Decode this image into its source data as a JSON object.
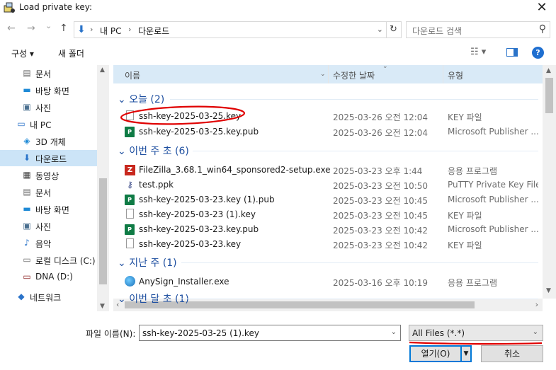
{
  "window": {
    "title": "Load private key:",
    "close_glyph": "✕"
  },
  "navigation": {
    "back_glyph": "←",
    "forward_glyph": "→",
    "recent_glyph": "⌄",
    "up_glyph": "↑",
    "breadcrumb": [
      "내 PC",
      "다운로드"
    ],
    "breadcrumb_sep": "›",
    "dropdown_glyph": "⌄",
    "refresh_glyph": "↻",
    "search_placeholder": "다운로드 검색",
    "search_glyph": "⚲"
  },
  "toolbar": {
    "organize_label": "구성 ▾",
    "new_folder_label": "새 폴더",
    "view_glyph": "☷ ▾",
    "help_glyph": "?"
  },
  "sidebar": {
    "items": [
      {
        "label": "문서",
        "icon": "documents-icon",
        "glyph": "▤",
        "color": "#6b6b6b"
      },
      {
        "label": "바탕 화면",
        "icon": "desktop-icon",
        "glyph": "▬",
        "color": "#1e8ad6"
      },
      {
        "label": "사진",
        "icon": "pictures-icon",
        "glyph": "▣",
        "color": "#4a6f8f"
      },
      {
        "label": "내 PC",
        "icon": "computer-icon",
        "glyph": "▭",
        "color": "#2a73c9"
      },
      {
        "label": "3D 개체",
        "icon": "3d-objects-icon",
        "glyph": "◈",
        "color": "#1e8ad6"
      },
      {
        "label": "다운로드",
        "icon": "downloads-icon",
        "glyph": "⬇",
        "color": "#2a73c9"
      },
      {
        "label": "동영상",
        "icon": "videos-icon",
        "glyph": "▦",
        "color": "#444"
      },
      {
        "label": "문서",
        "icon": "documents-icon",
        "glyph": "▤",
        "color": "#6b6b6b"
      },
      {
        "label": "바탕 화면",
        "icon": "desktop-icon",
        "glyph": "▬",
        "color": "#1e8ad6"
      },
      {
        "label": "사진",
        "icon": "pictures-icon",
        "glyph": "▣",
        "color": "#4a6f8f"
      },
      {
        "label": "음악",
        "icon": "music-icon",
        "glyph": "♪",
        "color": "#2a73c9"
      },
      {
        "label": "로컬 디스크 (C:)",
        "icon": "local-disk-icon",
        "glyph": "▭",
        "color": "#6b6b6b"
      },
      {
        "label": "DNA (D:)",
        "icon": "drive-icon",
        "glyph": "▭",
        "color": "#8a1c1c"
      },
      {
        "label": "네트워크",
        "icon": "network-icon",
        "glyph": "◆",
        "color": "#2a73c9"
      }
    ],
    "selected_index": 5
  },
  "columns": {
    "name": "이름",
    "date": "수정한 날짜",
    "type": "유형"
  },
  "groups": [
    {
      "label": "오늘 (2)"
    },
    {
      "label": "이번 주 초 (6)"
    },
    {
      "label": "지난 주 (1)"
    },
    {
      "label": "이번 달 초 (1)"
    }
  ],
  "files": [
    {
      "name": "ssh-key-2025-03-25.key",
      "date": "2025-03-26 오전 12:04",
      "type": "KEY 파일",
      "icon": "key-file-icon",
      "kind": "doc"
    },
    {
      "name": "ssh-key-2025-03-25.key.pub",
      "date": "2025-03-26 오전 12:04",
      "type": "Microsoft Publisher ...",
      "icon": "publisher-file-icon",
      "kind": "pub"
    },
    {
      "name": "FileZilla_3.68.1_win64_sponsored2-setup.exe",
      "date": "2025-03-23 오후 1:44",
      "type": "응용 프로그램",
      "icon": "filezilla-icon",
      "kind": "fz"
    },
    {
      "name": "test.ppk",
      "date": "2025-03-23 오전 10:50",
      "type": "PuTTY Private Key File",
      "icon": "putty-key-icon",
      "kind": "ppk"
    },
    {
      "name": "ssh-key-2025-03-23.key (1).pub",
      "date": "2025-03-23 오전 10:45",
      "type": "Microsoft Publisher ...",
      "icon": "publisher-file-icon",
      "kind": "pub"
    },
    {
      "name": "ssh-key-2025-03-23 (1).key",
      "date": "2025-03-23 오전 10:45",
      "type": "KEY 파일",
      "icon": "key-file-icon",
      "kind": "doc"
    },
    {
      "name": "ssh-key-2025-03-23.key.pub",
      "date": "2025-03-23 오전 10:42",
      "type": "Microsoft Publisher ...",
      "icon": "publisher-file-icon",
      "kind": "pub"
    },
    {
      "name": "ssh-key-2025-03-23.key",
      "date": "2025-03-23 오전 10:42",
      "type": "KEY 파일",
      "icon": "key-file-icon",
      "kind": "doc"
    },
    {
      "name": "AnySign_Installer.exe",
      "date": "2025-03-16 오후 10:19",
      "type": "응용 프로그램",
      "icon": "anysign-icon",
      "kind": "any"
    }
  ],
  "bottom": {
    "filename_label": "파일 이름(N):",
    "filename_value": "ssh-key-2025-03-25 (1).key",
    "filter_value": "All Files (*.*)",
    "open_label": "열기(O)",
    "cancel_label": "취소"
  },
  "colors": {
    "accent": "#0078d7",
    "selected_bg": "#cce4f7",
    "group_text": "#1e4fa0",
    "annotation_red": "#e00000"
  }
}
